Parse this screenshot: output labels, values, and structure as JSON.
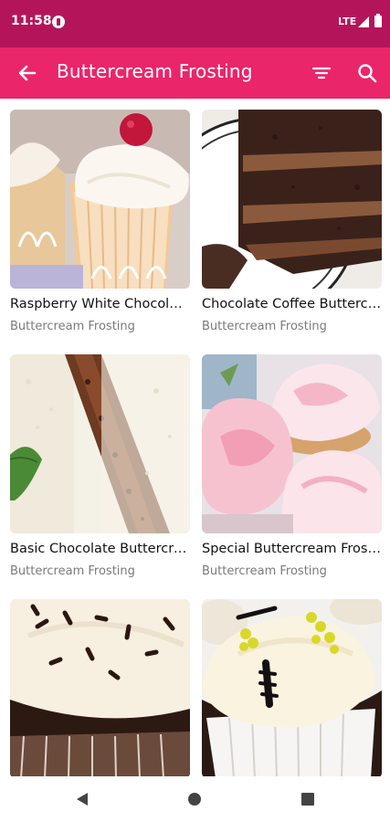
{
  "status_bar": {
    "time": "11:58",
    "network": "LTE",
    "icons": [
      "app-notification-icon",
      "signal-icon",
      "battery-icon"
    ]
  },
  "app_bar": {
    "title": "Buttercream Frosting",
    "background": "#ea2569",
    "icons": [
      "back-arrow-icon",
      "filter-icon",
      "search-icon"
    ]
  },
  "recipes": [
    {
      "title": "Raspberry White Chocolate Buttercream",
      "category": "Buttercream Frosting"
    },
    {
      "title": "Chocolate Coffee Buttercream",
      "category": "Buttercream Frosting"
    },
    {
      "title": "Basic Chocolate Buttercream",
      "category": "Buttercream Frosting"
    },
    {
      "title": "Special Buttercream Frosting",
      "category": "Buttercream Frosting"
    },
    {
      "title": "",
      "category": ""
    },
    {
      "title": "",
      "category": ""
    }
  ],
  "nav_bar": {
    "icons": [
      "nav-back-icon",
      "nav-home-icon",
      "nav-recents-icon"
    ]
  }
}
